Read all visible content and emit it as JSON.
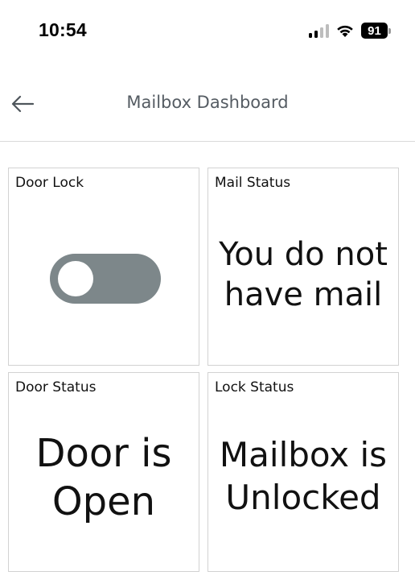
{
  "status_bar": {
    "time": "10:54",
    "battery": "91",
    "icons": [
      "signal-icon",
      "wifi-icon",
      "battery-icon"
    ]
  },
  "header": {
    "title": "Mailbox Dashboard",
    "back_icon": "arrow-left-icon"
  },
  "cards": {
    "door_lock": {
      "title": "Door Lock",
      "toggle_on": false
    },
    "mail_status": {
      "title": "Mail Status",
      "line1": "You do not",
      "line2": "have mail"
    },
    "door_status": {
      "title": "Door Status",
      "line1": "Door is",
      "line2": "Open"
    },
    "lock_status": {
      "title": "Lock Status",
      "line1": "Mailbox is",
      "line2": "Unlocked"
    }
  },
  "colors": {
    "toggle_track": "#7d878a",
    "title_text": "#555c63",
    "card_border": "#d2d2d2"
  }
}
